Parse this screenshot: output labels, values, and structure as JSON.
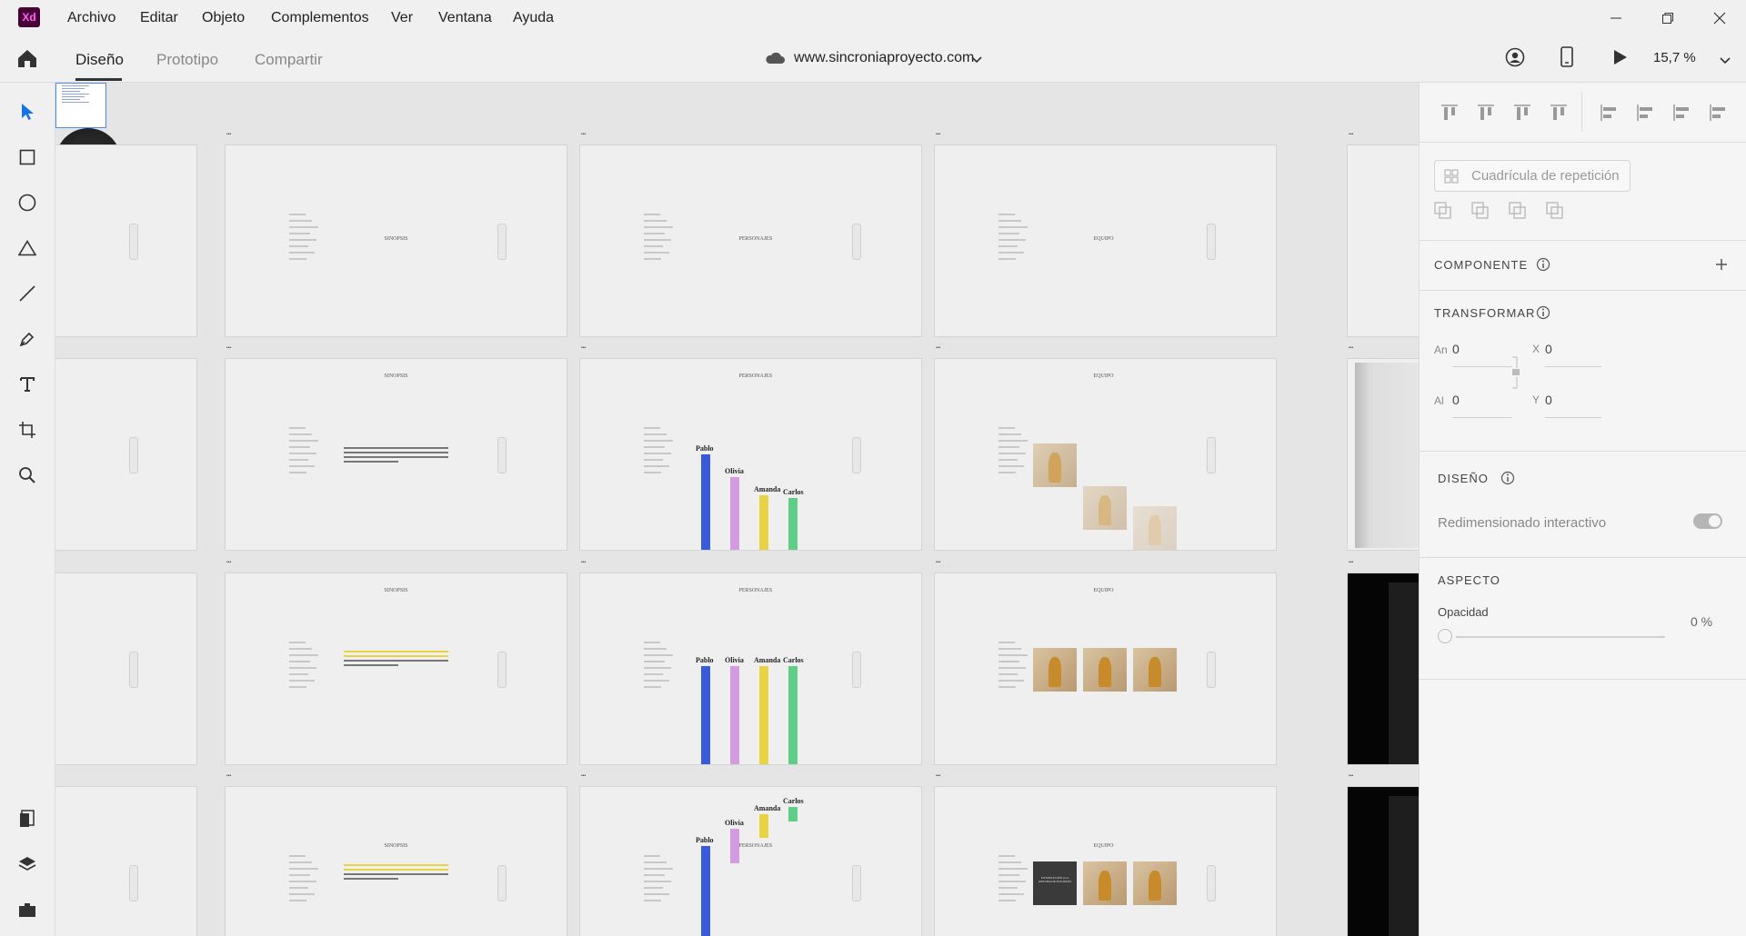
{
  "app": {
    "logo": "Xd"
  },
  "menu": [
    "Archivo",
    "Editar",
    "Objeto",
    "Complementos",
    "Ver",
    "Ventana",
    "Ayuda"
  ],
  "tabs": [
    {
      "label": "Diseño",
      "active": true
    },
    {
      "label": "Prototipo",
      "active": false
    },
    {
      "label": "Compartir",
      "active": false
    }
  ],
  "document": {
    "name": "www.sincroniaproyecto.com",
    "icon": "cloud-icon"
  },
  "zoom": "15,7 %",
  "tools": [
    "select-icon",
    "rectangle-icon",
    "ellipse-icon",
    "polygon-icon",
    "line-icon",
    "pen-icon",
    "text-icon",
    "artboard-icon",
    "zoom-icon"
  ],
  "bottom_tools": [
    "assets-icon",
    "layers-icon",
    "plugins-icon"
  ],
  "artboards": {
    "titles": [
      "SINOPSIS",
      "PERSONAJES",
      "EQUIPO"
    ],
    "chart_labels": [
      "Pablo",
      "Olivia",
      "Amanda",
      "Carlos"
    ],
    "card_text": "INTRODUCCIÓN A LA HISTORIA DE SINCRONÍA"
  },
  "panel": {
    "repeat_grid": "Cuadrícula de repetición",
    "component": "COMPONENTE",
    "transform": "TRANSFORMAR",
    "w_label": "An",
    "w_value": "0",
    "x_label": "X",
    "x_value": "0",
    "h_label": "Al",
    "h_value": "0",
    "y_label": "Y",
    "y_value": "0",
    "layout": "DISEÑO",
    "responsive_resize": "Redimensionado interactivo",
    "appearance": "ASPECTO",
    "opacity_label": "Opacidad",
    "opacity_value": "0 %"
  },
  "colors": {
    "accent": "#1473e6",
    "xd_bg": "#470137",
    "xd_fg": "#ff61f6",
    "bar_blue": "#3a5bd9",
    "bar_pink": "#d49be0",
    "bar_yellow": "#e8d443",
    "bar_green": "#5fcf87"
  }
}
